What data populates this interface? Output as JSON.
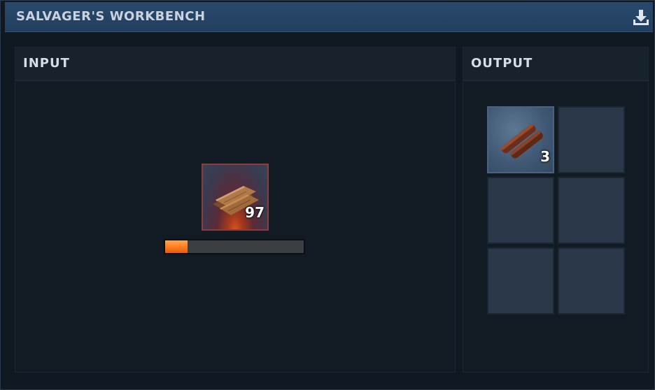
{
  "window": {
    "title": "SALVAGER'S WORKBENCH",
    "icons": {
      "action": "download-icon"
    }
  },
  "input": {
    "title": "INPUT",
    "slot": {
      "item_icon": "wood-planks-icon",
      "quantity": "97"
    },
    "progress": {
      "fraction": 0.16,
      "color": "#ff8a2a"
    }
  },
  "output": {
    "title": "OUTPUT",
    "slots": [
      {
        "item_icon": "wood-sticks-icon",
        "quantity": "3"
      },
      {
        "item_icon": "",
        "quantity": ""
      },
      {
        "item_icon": "",
        "quantity": ""
      },
      {
        "item_icon": "",
        "quantity": ""
      },
      {
        "item_icon": "",
        "quantity": ""
      },
      {
        "item_icon": "",
        "quantity": ""
      }
    ]
  },
  "colors": {
    "titlebar": "#22405f",
    "panel": "#141e28",
    "slot": "#2a3849",
    "input_slot_border": "#8a3e3f"
  }
}
